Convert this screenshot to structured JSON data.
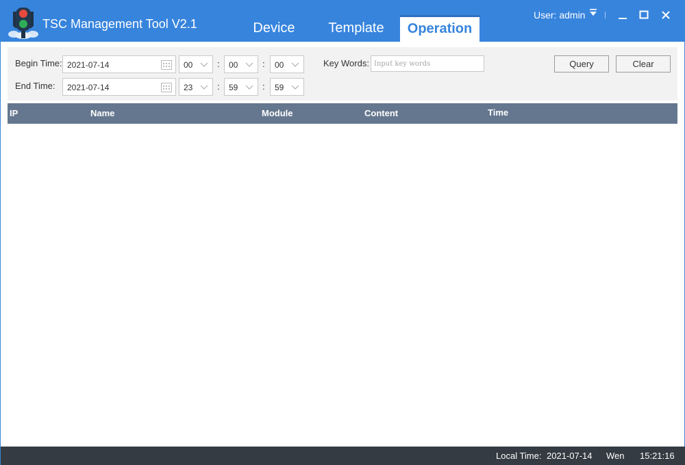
{
  "app": {
    "title": "TSC Management Tool V2.1",
    "accent_color": "#3784dd"
  },
  "nav": {
    "tabs": [
      {
        "label": "Device",
        "active": false
      },
      {
        "label": "Template",
        "active": false
      },
      {
        "label": "Operation",
        "active": true
      }
    ]
  },
  "user": {
    "label": "User: admin"
  },
  "window_controls": {
    "icons": [
      "minimize-icon",
      "maximize-icon",
      "close-icon"
    ]
  },
  "filter": {
    "begin_label": "Begin Time:",
    "end_label": "End Time:",
    "begin_date": "2021-07-14",
    "begin_hour": "00",
    "begin_minute": "00",
    "begin_second": "00",
    "end_date": "2021-07-14",
    "end_hour": "23",
    "end_minute": "59",
    "end_second": "59",
    "colon": ":",
    "keywords_label": "Key Words:",
    "keywords_value": "",
    "keywords_placeholder": "Input key words",
    "query_label": "Query",
    "clear_label": "Clear"
  },
  "table": {
    "columns": [
      "IP",
      "Name",
      "Module",
      "Content",
      "Time"
    ],
    "rows": [],
    "header_color": "#65778f"
  },
  "status": {
    "local_time_label": "Local Time:",
    "date": "2021-07-14",
    "weekday": "Wen",
    "time": "15:21:16"
  }
}
